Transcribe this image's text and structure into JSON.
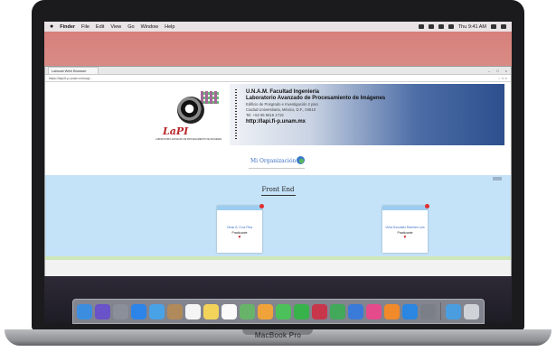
{
  "device": {
    "label": "MacBook Pro"
  },
  "menubar": {
    "apple": "",
    "items": [
      "Finder",
      "File",
      "Edit",
      "View",
      "Go",
      "Window",
      "Help"
    ],
    "clock": "Thu 9:41 AM"
  },
  "browser": {
    "tab_title": "Laborat Web Browser",
    "url": "https://lapi.fi-p.unam.mx/org/...",
    "tools": "☆ ↻ ≡"
  },
  "banner": {
    "logo_text": "LaPI",
    "logo_sub": "LABORATORIO AVANZADO DE PROCESAMIENTO DE IMÁGENES",
    "line1": "U.N.A.M. Facultad Ingeniería",
    "line2": "Laboratorio Avanzado de Procesamiento de Imágenes",
    "line3": "Edificio de Posgrado e Investigación 2 piso",
    "line4": "Ciudad Universitaria, México, D.F., 04510",
    "line5": "Tel. +52 55 5616 1719",
    "line6": "http://lapi.fi-p.unam.mx"
  },
  "org": {
    "link": "Mi Organización"
  },
  "section": {
    "title": "Front End"
  },
  "cards": [
    {
      "name": "Omar A. Cruz Pina",
      "role": "Practicante",
      "heart": "♥"
    },
    {
      "name": "Viela Gonzalez Ramirez Luis",
      "role": "Practicante",
      "heart": "♥"
    }
  ],
  "dock": {
    "apps": [
      {
        "icon": "finder-icon",
        "color": "#3b8de0"
      },
      {
        "icon": "siri-icon",
        "color": "#6a52c8"
      },
      {
        "icon": "launchpad-icon",
        "color": "#8a8f99"
      },
      {
        "icon": "safari-icon",
        "color": "#2d84e8"
      },
      {
        "icon": "mail-icon",
        "color": "#4aa2e6"
      },
      {
        "icon": "contacts-icon",
        "color": "#b08a5a"
      },
      {
        "icon": "calendar-icon",
        "color": "#f5f5f5"
      },
      {
        "icon": "notes-icon",
        "color": "#f3d35a"
      },
      {
        "icon": "reminders-icon",
        "color": "#fafafa"
      },
      {
        "icon": "maps-icon",
        "color": "#67b36a"
      },
      {
        "icon": "photos-icon",
        "color": "#f0a33a"
      },
      {
        "icon": "messages-icon",
        "color": "#4cc05a"
      },
      {
        "icon": "facetime-icon",
        "color": "#38b24a"
      },
      {
        "icon": "photobooth-icon",
        "color": "#c7364a"
      },
      {
        "icon": "numbers-icon",
        "color": "#42a85a"
      },
      {
        "icon": "keynote-icon",
        "color": "#3a7ad8"
      },
      {
        "icon": "itunes-icon",
        "color": "#e54a8a"
      },
      {
        "icon": "ibooks-icon",
        "color": "#f08a2a"
      },
      {
        "icon": "appstore-icon",
        "color": "#2a86e0"
      },
      {
        "icon": "preferences-icon",
        "color": "#7a7f88"
      }
    ],
    "extras": [
      {
        "icon": "downloads-icon",
        "color": "#4a9ee0"
      },
      {
        "icon": "trash-icon",
        "color": "#cfd3d8"
      }
    ]
  }
}
